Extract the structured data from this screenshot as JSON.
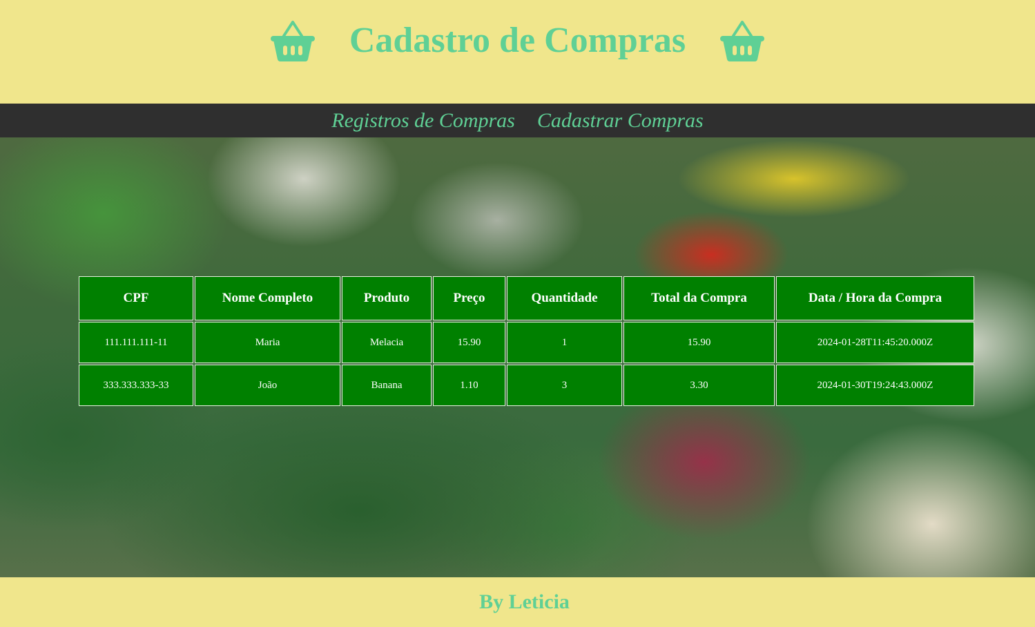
{
  "header": {
    "title": "Cadastro de Compras",
    "left_icon": "basket-icon",
    "right_icon": "basket-icon",
    "accent_color": "#5fd095",
    "background_color": "#f0e68c"
  },
  "nav": {
    "items": [
      {
        "label": "Registros de Compras"
      },
      {
        "label": "Cadastrar Compras"
      }
    ],
    "background_color": "#2f2f2f"
  },
  "table": {
    "columns": [
      "CPF",
      "Nome Completo",
      "Produto",
      "Preço",
      "Quantidade",
      "Total da Compra",
      "Data / Hora da Compra"
    ],
    "rows": [
      [
        "111.111.111-11",
        "Maria",
        "Melacia",
        "15.90",
        "1",
        "15.90",
        "2024-01-28T11:45:20.000Z"
      ],
      [
        "333.333.333-33",
        "João",
        "Banana",
        "1.10",
        "3",
        "3.30",
        "2024-01-30T19:24:43.000Z"
      ]
    ],
    "cell_color": "#008000"
  },
  "footer": {
    "text": "By Leticia"
  }
}
